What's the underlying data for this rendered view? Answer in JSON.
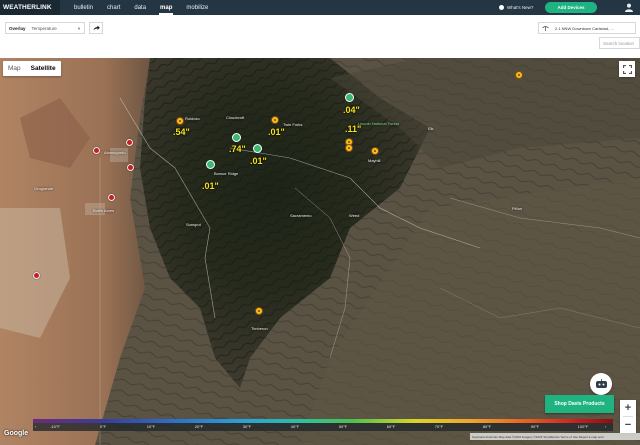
{
  "navbar": {
    "brand": "WEATHERLINK",
    "items": [
      {
        "label": "bulletin",
        "active": false
      },
      {
        "label": "chart",
        "active": false
      },
      {
        "label": "data",
        "active": false
      },
      {
        "label": "map",
        "active": true
      },
      {
        "label": "mobilize",
        "active": false
      }
    ],
    "whats_new": "What's New?",
    "add_devices": "Add Devices",
    "icons": {
      "user": "user-icon",
      "whats_new": "info-dot-icon"
    }
  },
  "toolbar": {
    "overlay_label": "Overlay",
    "overlay_value": "Temperature",
    "station_label": "2.1 NNW Downtown Carlsbad, ...",
    "search_placeholder": "Search location"
  },
  "map": {
    "type_options": [
      "Map",
      "Satellite"
    ],
    "selected_type": "Satellite",
    "rain_labels": [
      ".54\"",
      ".01\"",
      ".74\"",
      ".01\"",
      ".01\"",
      ".04\"",
      ".11\""
    ],
    "places": [
      "Ruidoso",
      "Cloudcroft",
      "Twin Forks",
      "Bonsor Ridge",
      "Mayhill",
      "Sacramento",
      "Weed",
      "Sunspot",
      "Timberon",
      "Alamogordo",
      "Boles Acres",
      "Orogrande",
      "Piñon",
      "Lincoln National Forest",
      "Elk"
    ],
    "scale": {
      "labels": [
        "-10°F",
        "0°F",
        "10°F",
        "20°F",
        "30°F",
        "40°F",
        "50°F",
        "60°F",
        "70°F",
        "80°F",
        "90°F",
        "100°F"
      ]
    },
    "shop_button": "Shop Davis Products",
    "zoom_in": "+",
    "zoom_out": "−",
    "google": "Google",
    "attribution": "Keyboard shortcuts  Map data ©2023 Imagery ©2023 TerraMetrics  Terms of Use  Report a map error",
    "colors": {
      "accent": "#1fb382",
      "navbar": "#243643",
      "rain_text": "#f5e41c"
    }
  }
}
